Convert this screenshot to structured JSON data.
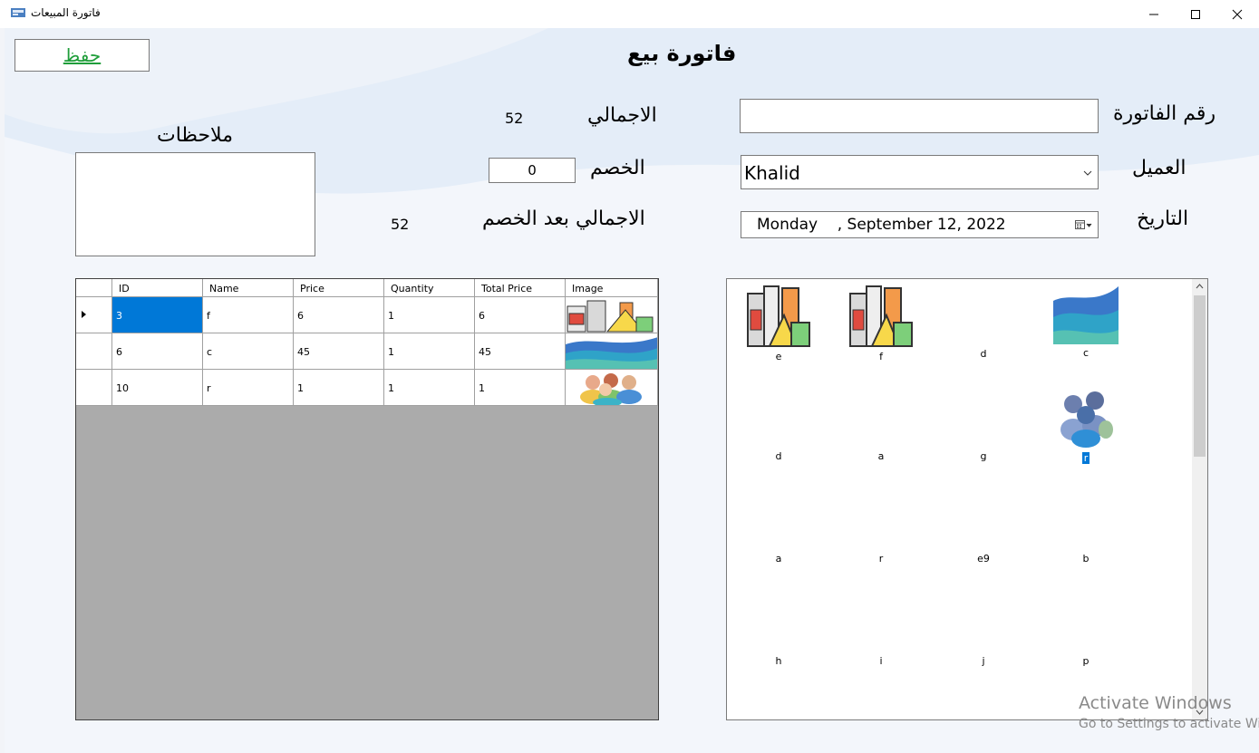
{
  "window": {
    "title": "فاتورة المبيعات",
    "controls": [
      "minimize-icon",
      "maximize-icon",
      "close-icon"
    ]
  },
  "form": {
    "heading": "فاتورة بيع",
    "save_label": "حفظ",
    "invoice_number_label": "رقم الفاتورة",
    "invoice_number_value": "",
    "customer_label": "العميل",
    "customer_value": "Khalid",
    "date_label": "التاريخ",
    "date_value": "Monday    , September 12, 2022",
    "total_label": "الاجمالي",
    "total_value": "52",
    "discount_label": "الخصم",
    "discount_value": "0",
    "net_label": "الاجمالي بعد الخصم",
    "net_value": "52",
    "notes_label": "ملاحظات",
    "notes_value": ""
  },
  "grid": {
    "columns": [
      "ID",
      "Name",
      "Price",
      "Quantity",
      "Total Price",
      "Image"
    ],
    "rows": [
      {
        "id": "3",
        "name": "f",
        "price": "6",
        "quantity": "1",
        "total": "6",
        "image": "food-drinks-icon"
      },
      {
        "id": "6",
        "name": "c",
        "price": "45",
        "quantity": "1",
        "total": "45",
        "image": "wave-icon"
      },
      {
        "id": "10",
        "name": "r",
        "price": "1",
        "quantity": "1",
        "total": "1",
        "image": "people-group-icon"
      }
    ]
  },
  "products": [
    {
      "label": "e",
      "icon": "food-drinks-icon"
    },
    {
      "label": "f",
      "icon": "food-drinks-icon"
    },
    {
      "label": "d",
      "icon": ""
    },
    {
      "label": "c",
      "icon": "wave-icon"
    },
    {
      "label": "d",
      "icon": ""
    },
    {
      "label": "a",
      "icon": ""
    },
    {
      "label": "g",
      "icon": ""
    },
    {
      "label": "r",
      "icon": "people-group-icon",
      "selected": true
    },
    {
      "label": "a",
      "icon": ""
    },
    {
      "label": "r",
      "icon": ""
    },
    {
      "label": "e9",
      "icon": ""
    },
    {
      "label": "b",
      "icon": ""
    },
    {
      "label": "h",
      "icon": ""
    },
    {
      "label": "i",
      "icon": ""
    },
    {
      "label": "j",
      "icon": ""
    },
    {
      "label": "p",
      "icon": ""
    }
  ],
  "watermark": {
    "line1": "Activate Windows",
    "line2": "Go to Settings to activate Windows."
  },
  "colors": {
    "accent": "#0078d7",
    "save_text": "#1f9e3a",
    "grid_background": "#ababab"
  }
}
